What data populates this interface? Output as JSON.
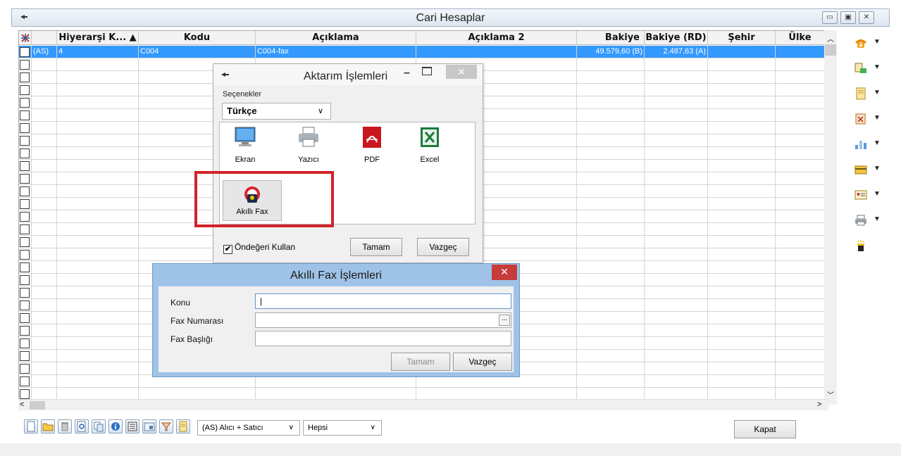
{
  "window": {
    "title": "Cari Hesaplar"
  },
  "grid": {
    "columns": [
      "Hiyerarşi K... ▲",
      "Kodu",
      "Açıklama",
      "Açıklama 2",
      "Bakiye",
      "Bakiye (RD)",
      "Şehir",
      "Ülke"
    ],
    "rows": [
      {
        "type": "(AS)",
        "hierarchy": "4",
        "code": "C004",
        "desc": "C004-fax",
        "desc2": "",
        "balance": "49.579,60 (B)",
        "balance_rd": "2.487,63 (A)",
        "city": "",
        "country": "",
        "selected": true
      }
    ],
    "empty_row_count": 27
  },
  "right_toolbar": {
    "icons": [
      "phone-icon",
      "contact-card-icon",
      "document-icon",
      "close-document-icon",
      "chart-icon",
      "card-icon",
      "id-card-icon",
      "printer-icon",
      "magic-wand-icon"
    ]
  },
  "bottom_toolbar": {
    "icons": [
      "new-icon",
      "open-icon",
      "delete-icon",
      "search-icon",
      "copy-icon",
      "info-icon",
      "list-icon",
      "report-icon",
      "filter-icon",
      "notes-icon"
    ],
    "account_type": "(AS) Alıcı + Satıcı",
    "filter": "Hepsi",
    "close_label": "Kapat"
  },
  "export_dialog": {
    "title": "Aktarım İşlemleri",
    "options_label": "Seçenekler",
    "language": "Türkçe",
    "targets": [
      {
        "label": "Ekran",
        "icon": "monitor-icon"
      },
      {
        "label": "Yazıcı",
        "icon": "printer-icon"
      },
      {
        "label": "PDF",
        "icon": "pdf-icon"
      },
      {
        "label": "Excel",
        "icon": "excel-icon"
      }
    ],
    "fax_label": "Akıllı Fax",
    "default_label": "Öndeğeri Kullan",
    "default_checked": true,
    "ok_label": "Tamam",
    "cancel_label": "Vazgeç"
  },
  "fax_dialog": {
    "title": "Akıllı Fax İşlemleri",
    "fields": [
      {
        "label": "Konu",
        "value": "|"
      },
      {
        "label": "Fax Numarası",
        "value": ""
      },
      {
        "label": "Fax Başlığı",
        "value": ""
      }
    ],
    "ok_label": "Tamam",
    "cancel_label": "Vazgeç"
  }
}
